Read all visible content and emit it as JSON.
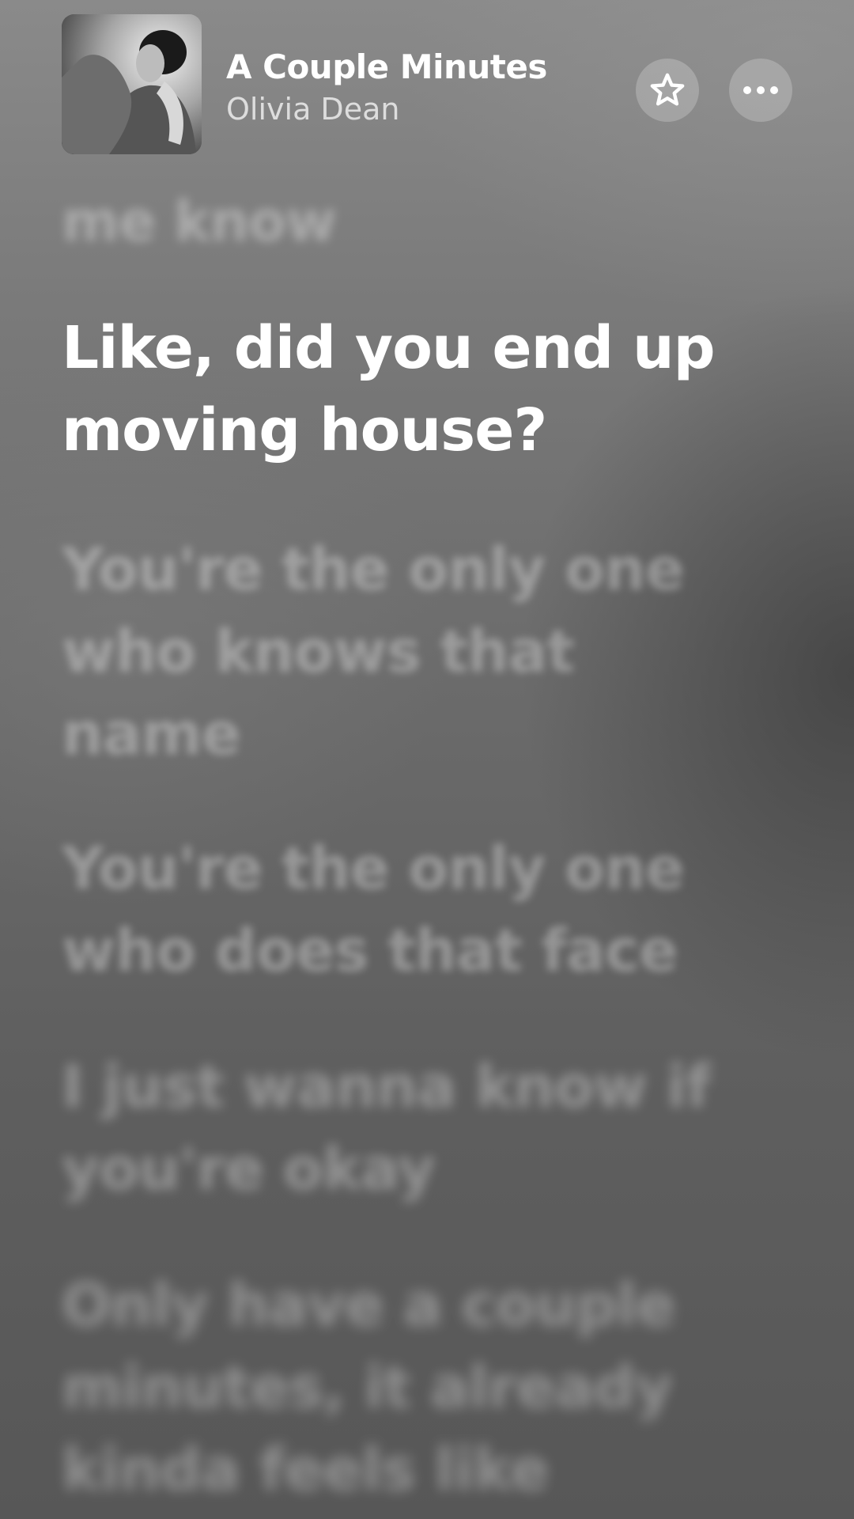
{
  "track": {
    "title": "A Couple Minutes",
    "artist": "Olivia Dean"
  },
  "icons": {
    "album_art": "album-cover-image",
    "favorite": "star-outline-icon",
    "more": "ellipsis-icon"
  },
  "lyrics": {
    "previous": "me know",
    "current": "Like, did you end up\nmoving house?",
    "upcoming": [
      "You're the only one\nwho knows that\nname",
      "You're the only one\nwho does that face",
      "I just wanna know if\nyou're okay",
      "Only have a couple\nminutes, it already\nkinda feels like"
    ]
  },
  "colors": {
    "active_lyric": "#ffffff",
    "inactive_lyric": "rgba(255,255,255,0.33)",
    "button_bg": "rgba(255,255,255,0.22)"
  }
}
